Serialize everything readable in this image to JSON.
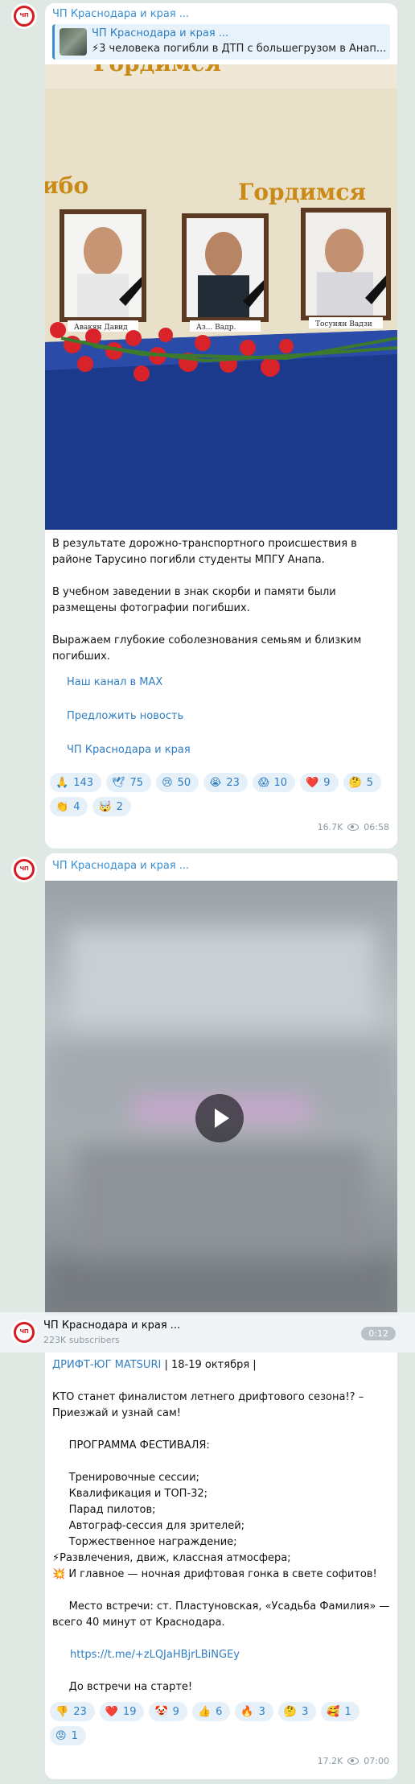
{
  "post1": {
    "channel": "ЧП Краснодара и края ...",
    "reply": {
      "name": "ЧП Краснодара и края ...",
      "text": "⚡3 человека погибли в ДТП с большегрузом в Анап..."
    },
    "photo": {
      "banner_top": "Гордимся",
      "banner_left": "ибо",
      "banner_mid": "Гордимся",
      "names": [
        "Авакян Давид",
        "Аз... Вадр.",
        "Тосунян Вадзи"
      ]
    },
    "paragraphs": [
      "В результате дорожно-транспортного происшествия в районе Тарусино погибли студенты МПГУ Анапа.",
      "В учебном заведении в знак скорби и памяти были размещены фотографии погибших.",
      "Выражаем глубокие соболезнования семьям и близким погибших."
    ],
    "links": [
      "Наш канал в MAX",
      "Предложить новость",
      "ЧП Краснодара и края"
    ],
    "reactions": [
      {
        "emoji": "🙏",
        "count": "143"
      },
      {
        "emoji": "🕊",
        "count": "75"
      },
      {
        "emoji": "😢",
        "count": "50"
      },
      {
        "emoji": "😭",
        "count": "23"
      },
      {
        "emoji": "😱",
        "count": "10"
      },
      {
        "emoji": "❤️",
        "count": "9"
      },
      {
        "emoji": "🤔",
        "count": "5"
      },
      {
        "emoji": "👏",
        "count": "4"
      },
      {
        "emoji": "🤯",
        "count": "2"
      }
    ],
    "views": "16.7K",
    "time": "06:58"
  },
  "post2": {
    "channel": "ЧП Краснодара и края ...",
    "sticky": {
      "name": "ЧП Краснодара и края ...",
      "subscribers": "223K subscribers",
      "duration": "0:12"
    },
    "headline_link": "ДРИФТ-ЮГ MATSURI",
    "headline_rest": " | 18-19 октября |",
    "lines": [
      "КТО станет финалистом летнего дрифтового сезона!? – Приезжай и узнай сам!",
      "",
      "     ПРОГРАММА ФЕСТИВАЛЯ:",
      "",
      "     Тренировочные сессии;",
      "     Квалификация и ТОП-32;",
      "     Парад пилотов;",
      "     Автограф-сессия для зрителей;",
      "     Торжественное награждение;",
      "⚡Развлечения, движ, классная атмосфера;",
      "💥 И главное — ночная дрифтовая гонка в свете софитов!",
      "",
      "     Место встречи: ст. Пластуновская, «Усадьба Фамилия» — всего 40 минут от Краснодара.",
      ""
    ],
    "url": "https://t.me/+zLQJaHBjrLBiNGEy",
    "closing": "     До встречи на старте!",
    "reactions": [
      {
        "emoji": "👎",
        "count": "23"
      },
      {
        "emoji": "❤️",
        "count": "19"
      },
      {
        "emoji": "🤡",
        "count": "9"
      },
      {
        "emoji": "👍",
        "count": "6"
      },
      {
        "emoji": "🔥",
        "count": "3"
      },
      {
        "emoji": "🤔",
        "count": "3"
      },
      {
        "emoji": "🥰",
        "count": "1"
      },
      {
        "emoji": "😡",
        "count": "1"
      }
    ],
    "views": "17.2K",
    "time": "07:00"
  },
  "avatar_text": "ЧП",
  "colors": {
    "accent": "#3a8fd0",
    "background": "#dfe8e3",
    "brand_red": "#d71920"
  }
}
